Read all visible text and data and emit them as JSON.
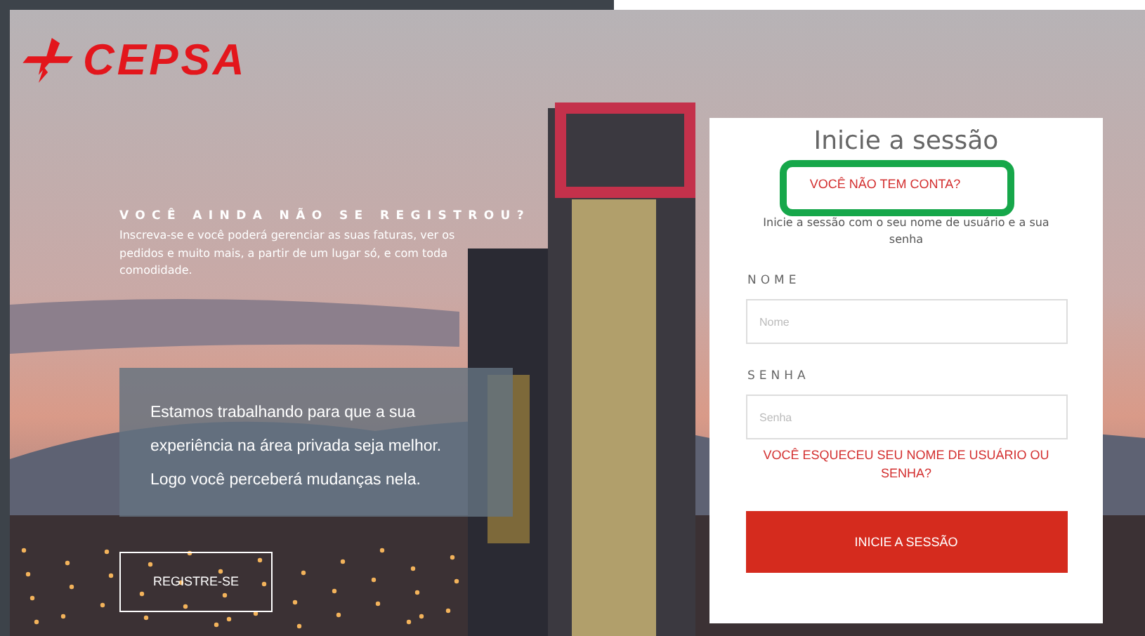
{
  "logo": {
    "text": "CEPSA"
  },
  "register": {
    "heading": "VOCÊ AINDA NÃO SE REGISTROU?",
    "text": "Inscreva-se e você poderá gerenciar as suas faturas, ver os pedidos e muito mais, a partir de um lugar só, e com toda comodidade.",
    "notice": "Estamos trabalhando para que a sua experiência na área privada seja melhor. Logo você perceberá mudanças nela.",
    "button": "REGISTRE-SE"
  },
  "login": {
    "title": "Inicie a sessão",
    "signup_link": "VOCÊ NÃO TEM CONTA?",
    "highlighted": true,
    "instructions": "Inicie a sessão com o seu nome de usuário e a sua senha",
    "fields": [
      {
        "label": "NOME",
        "placeholder": "Nome"
      },
      {
        "label": "SENHA",
        "placeholder": "Senha"
      }
    ],
    "forgot_link": "VOCÊ ESQUECEU SEU NOME DE USUÁRIO OU SENHA?",
    "submit": "INICIE A SESSÃO"
  }
}
